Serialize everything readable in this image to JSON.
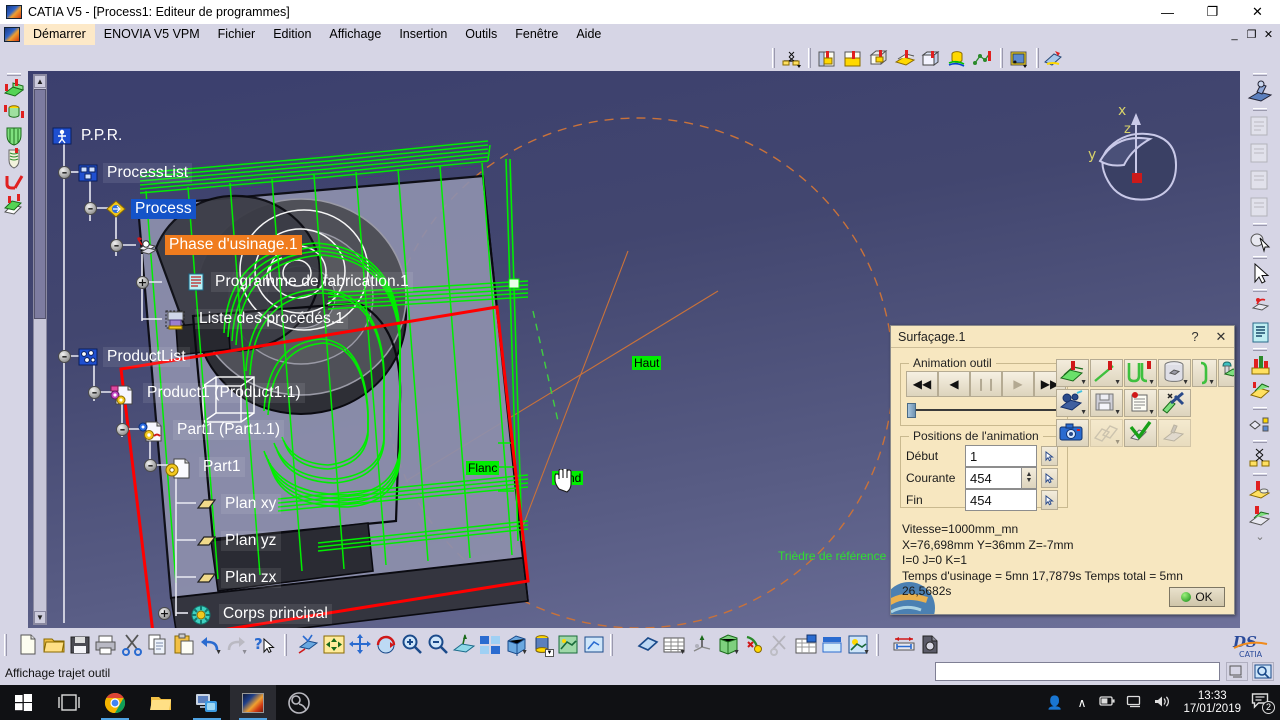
{
  "window": {
    "title": "CATIA V5 - [Process1: Editeur de programmes]",
    "minimize": "—",
    "maximize": "❐",
    "close": "✕",
    "mdi_minimize": "_",
    "mdi_restore": "❐",
    "mdi_close": "✕"
  },
  "menubar": {
    "items": [
      {
        "label": "Démarrer",
        "name": "menu-demarrer",
        "highlight": true
      },
      {
        "label": "ENOVIA V5 VPM",
        "name": "menu-enovia",
        "highlight": false
      },
      {
        "label": "Fichier",
        "name": "menu-fichier",
        "highlight": false
      },
      {
        "label": "Edition",
        "name": "menu-edition",
        "highlight": false
      },
      {
        "label": "Affichage",
        "name": "menu-affichage",
        "highlight": false
      },
      {
        "label": "Insertion",
        "name": "menu-insertion",
        "highlight": false
      },
      {
        "label": "Outils",
        "name": "menu-outils",
        "highlight": false
      },
      {
        "label": "Fenêtre",
        "name": "menu-fenetre",
        "highlight": false
      },
      {
        "label": "Aide",
        "name": "menu-aide",
        "highlight": false
      }
    ]
  },
  "tree": {
    "nodes": [
      {
        "label": "P.P.R.",
        "name": "tree-node-ppr",
        "style": "none",
        "icon": "ppr-icon"
      },
      {
        "label": "ProcessList",
        "name": "tree-node-processlist",
        "style": "plain",
        "icon": "processlist-icon"
      },
      {
        "label": "Process",
        "name": "tree-node-process",
        "style": "sel-blue",
        "icon": "process-icon"
      },
      {
        "label": "Phase d'usinage.1",
        "name": "tree-node-phase-usinage",
        "style": "sel-orange",
        "icon": "machining-setup-icon"
      },
      {
        "label": "Programme de fabrication.1",
        "name": "tree-node-programme-fabrication",
        "style": "plain",
        "icon": "manufacturing-program-icon"
      },
      {
        "label": "Liste des procédés.1",
        "name": "tree-node-liste-procedes",
        "style": "plain",
        "icon": "process-list-icon"
      },
      {
        "label": "ProductList",
        "name": "tree-node-productlist",
        "style": "plain",
        "icon": "productlist-icon"
      },
      {
        "label": "Product1 (Product1.1)",
        "name": "tree-node-product1",
        "style": "plain",
        "icon": "product-icon"
      },
      {
        "label": "Part1 (Part1.1)",
        "name": "tree-node-part1-instance",
        "style": "plain",
        "icon": "part-instance-icon"
      },
      {
        "label": "Part1",
        "name": "tree-node-part1",
        "style": "plain",
        "icon": "part-icon"
      },
      {
        "label": "Plan xy",
        "name": "tree-node-plan-xy",
        "style": "plain",
        "icon": "plane-icon"
      },
      {
        "label": "Plan yz",
        "name": "tree-node-plan-yz",
        "style": "plain",
        "icon": "plane-icon"
      },
      {
        "label": "Plan zx",
        "name": "tree-node-plan-zx",
        "style": "plain",
        "icon": "plane-icon"
      },
      {
        "label": "Corps principal",
        "name": "tree-node-corps-principal",
        "style": "plain",
        "icon": "body-icon"
      }
    ],
    "expander_collapse": "–",
    "expander_expand": "+"
  },
  "viewport": {
    "labels": [
      {
        "text": "Haut",
        "name": "viewport-label-haut"
      },
      {
        "text": "Flanc",
        "name": "viewport-label-flanc"
      },
      {
        "text": "Fond",
        "name": "viewport-label-fond"
      },
      {
        "text": "Trièdre de référence",
        "name": "viewport-label-triedre"
      }
    ],
    "compass": {
      "x": "x",
      "y": "y",
      "z": "z"
    }
  },
  "dialog": {
    "title": "Surfaçage.1",
    "help": "?",
    "close": "✕",
    "animation_group": "Animation outil",
    "transport": [
      {
        "glyph": "◀◀",
        "name": "anim-rewind-button",
        "enabled": true
      },
      {
        "glyph": "◀",
        "name": "anim-step-back-button",
        "enabled": true
      },
      {
        "glyph": "❙❙",
        "name": "anim-pause-button",
        "enabled": false
      },
      {
        "glyph": "▶",
        "name": "anim-play-button",
        "enabled": false
      },
      {
        "glyph": "▶▶",
        "name": "anim-forward-button",
        "enabled": true
      }
    ],
    "positions_group": "Positions de l'animation",
    "fields": [
      {
        "label": "Début",
        "value": "1",
        "name": "position-debut",
        "spinner": false
      },
      {
        "label": "Courante",
        "value": "454",
        "name": "position-courante",
        "spinner": true
      },
      {
        "label": "Fin",
        "value": "454",
        "name": "position-fin",
        "spinner": false
      }
    ],
    "info": [
      "Vitesse=1000mm_mn",
      "X=76,698mm  Y=36mm  Z=-7mm",
      "I=0 J=0 K=1",
      "Temps d'usinage = 5mn 17,7879s   Temps total = 5mn 26,5682s"
    ],
    "ok_label": "OK",
    "tool_icons": [
      {
        "name": "tool-path-display-icon",
        "row": 0
      },
      {
        "name": "tool-path-line-icon",
        "row": 0
      },
      {
        "name": "tool-path-multi-icon",
        "row": 0
      },
      {
        "name": "stock-cylinder-icon",
        "row": 0
      },
      {
        "name": "tool-clamp-icon",
        "row": 0
      },
      {
        "name": "tool-assembly-icon",
        "row": 0
      },
      {
        "name": "video-simulation-icon",
        "row": 1
      },
      {
        "name": "save-result-icon",
        "row": 1
      },
      {
        "name": "report-icon",
        "row": 1
      },
      {
        "name": "collision-check-icon",
        "row": 1
      },
      {
        "name": "photo-snapshot-icon",
        "row": 2
      },
      {
        "name": "compare-icon",
        "row": 2
      },
      {
        "name": "analyze-check-icon",
        "row": 2
      },
      {
        "name": "measure-icon",
        "row": 2
      }
    ]
  },
  "statusbar": {
    "text": "Affichage trajet outil",
    "power_input_value": ""
  },
  "taskbar": {
    "items": [
      {
        "name": "start-button",
        "icon": "windows-logo-icon",
        "active": false
      },
      {
        "name": "task-view-button",
        "icon": "task-view-icon",
        "active": false
      },
      {
        "name": "taskbar-chrome",
        "icon": "chrome-icon",
        "active": false,
        "running": true
      },
      {
        "name": "taskbar-explorer",
        "icon": "folder-icon",
        "active": false,
        "running": false
      },
      {
        "name": "taskbar-remote",
        "icon": "remote-desktop-icon",
        "active": false,
        "running": true
      },
      {
        "name": "taskbar-catia",
        "icon": "catia-icon",
        "active": true,
        "running": true
      },
      {
        "name": "taskbar-obs",
        "icon": "obs-icon",
        "active": false,
        "running": false
      }
    ],
    "tray": {
      "people": "☺",
      "chevron": "∧",
      "battery": "▭",
      "network": "⎕",
      "volume": "◂",
      "time": "13:33",
      "date": "17/01/2019",
      "notification_count": "2"
    }
  },
  "colors": {
    "accent_orange": "#f07c1e",
    "accent_blue": "#1453c8",
    "toolpath_green": "#00ee00",
    "stock_red": "#ff0000",
    "dialog_bg": "#f7e7c0",
    "chrome_bg": "#d6d5e5"
  }
}
